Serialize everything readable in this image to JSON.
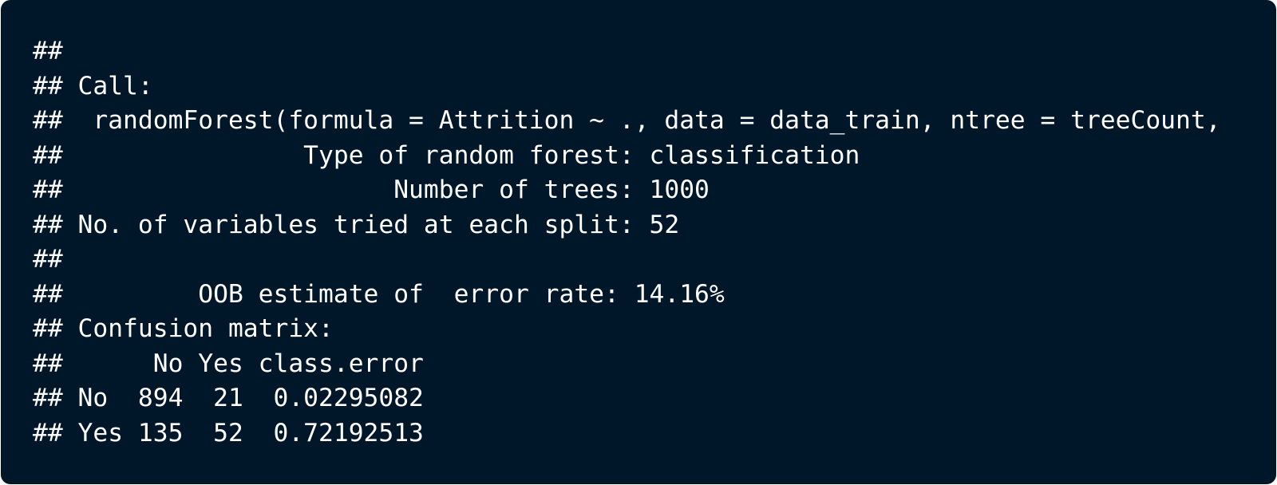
{
  "output_lines": [
    "##",
    "## Call:",
    "##  randomForest(formula = Attrition ~ ., data = data_train, ntree = treeCount,",
    "##                Type of random forest: classification",
    "##                      Number of trees: 1000",
    "## No. of variables tried at each split: 52",
    "##",
    "##         OOB estimate of  error rate: 14.16%",
    "## Confusion matrix:",
    "##      No Yes class.error",
    "## No  894  21  0.02295082",
    "## Yes 135  52  0.72192513"
  ]
}
